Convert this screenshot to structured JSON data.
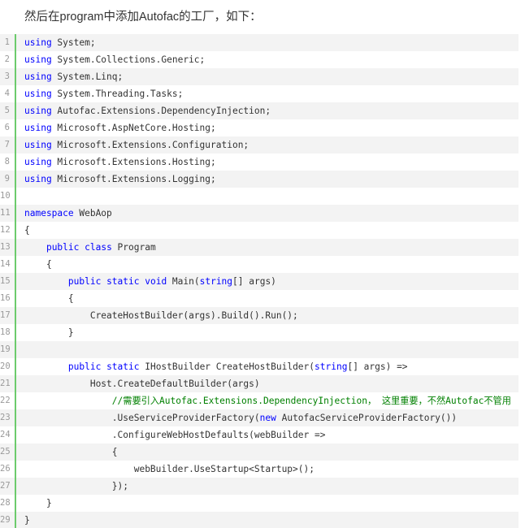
{
  "intro_text": "然后在program中添加Autofac的工厂，如下：",
  "colors": {
    "keyword": "#0000ff",
    "comment": "#008000",
    "text": "#333333",
    "line_number": "#9a9a9a",
    "gutter_border": "#6ccb6c",
    "odd_line_bg": "#f3f3f3"
  },
  "code_lines": [
    {
      "number": "1",
      "indent": "",
      "tokens": [
        {
          "t": "using",
          "k": "kw"
        },
        {
          "t": " System;",
          "k": ""
        }
      ]
    },
    {
      "number": "2",
      "indent": "",
      "tokens": [
        {
          "t": "using",
          "k": "kw"
        },
        {
          "t": " System.Collections.Generic;",
          "k": ""
        }
      ]
    },
    {
      "number": "3",
      "indent": "",
      "tokens": [
        {
          "t": "using",
          "k": "kw"
        },
        {
          "t": " System.Linq;",
          "k": ""
        }
      ]
    },
    {
      "number": "4",
      "indent": "",
      "tokens": [
        {
          "t": "using",
          "k": "kw"
        },
        {
          "t": " System.Threading.Tasks;",
          "k": ""
        }
      ]
    },
    {
      "number": "5",
      "indent": "",
      "tokens": [
        {
          "t": "using",
          "k": "kw"
        },
        {
          "t": " Autofac.Extensions.DependencyInjection;",
          "k": ""
        }
      ]
    },
    {
      "number": "6",
      "indent": "",
      "tokens": [
        {
          "t": "using",
          "k": "kw"
        },
        {
          "t": " Microsoft.AspNetCore.Hosting;",
          "k": ""
        }
      ]
    },
    {
      "number": "7",
      "indent": "",
      "tokens": [
        {
          "t": "using",
          "k": "kw"
        },
        {
          "t": " Microsoft.Extensions.Configuration;",
          "k": ""
        }
      ]
    },
    {
      "number": "8",
      "indent": "",
      "tokens": [
        {
          "t": "using",
          "k": "kw"
        },
        {
          "t": " Microsoft.Extensions.Hosting;",
          "k": ""
        }
      ]
    },
    {
      "number": "9",
      "indent": "",
      "tokens": [
        {
          "t": "using",
          "k": "kw"
        },
        {
          "t": " Microsoft.Extensions.Logging;",
          "k": ""
        }
      ]
    },
    {
      "number": "10",
      "indent": "",
      "tokens": []
    },
    {
      "number": "11",
      "indent": "",
      "tokens": [
        {
          "t": "namespace",
          "k": "kw"
        },
        {
          "t": " WebAop",
          "k": ""
        }
      ]
    },
    {
      "number": "12",
      "indent": "",
      "tokens": [
        {
          "t": "{",
          "k": ""
        }
      ]
    },
    {
      "number": "13",
      "indent": "    ",
      "tokens": [
        {
          "t": "public",
          "k": "kw"
        },
        {
          "t": " ",
          "k": ""
        },
        {
          "t": "class",
          "k": "kw"
        },
        {
          "t": " Program",
          "k": ""
        }
      ]
    },
    {
      "number": "14",
      "indent": "    ",
      "tokens": [
        {
          "t": "{",
          "k": ""
        }
      ]
    },
    {
      "number": "15",
      "indent": "        ",
      "tokens": [
        {
          "t": "public",
          "k": "kw"
        },
        {
          "t": " ",
          "k": ""
        },
        {
          "t": "static",
          "k": "kw"
        },
        {
          "t": " ",
          "k": ""
        },
        {
          "t": "void",
          "k": "kw"
        },
        {
          "t": " Main(",
          "k": ""
        },
        {
          "t": "string",
          "k": "kw"
        },
        {
          "t": "[] args)",
          "k": ""
        }
      ]
    },
    {
      "number": "16",
      "indent": "        ",
      "tokens": [
        {
          "t": "{",
          "k": ""
        }
      ]
    },
    {
      "number": "17",
      "indent": "            ",
      "tokens": [
        {
          "t": "CreateHostBuilder(args).Build().Run();",
          "k": ""
        }
      ]
    },
    {
      "number": "18",
      "indent": "        ",
      "tokens": [
        {
          "t": "}",
          "k": ""
        }
      ]
    },
    {
      "number": "19",
      "indent": "",
      "tokens": []
    },
    {
      "number": "20",
      "indent": "        ",
      "tokens": [
        {
          "t": "public",
          "k": "kw"
        },
        {
          "t": " ",
          "k": ""
        },
        {
          "t": "static",
          "k": "kw"
        },
        {
          "t": " IHostBuilder CreateHostBuilder(",
          "k": ""
        },
        {
          "t": "string",
          "k": "kw"
        },
        {
          "t": "[] args) =>",
          "k": ""
        }
      ]
    },
    {
      "number": "21",
      "indent": "            ",
      "tokens": [
        {
          "t": "Host.CreateDefaultBuilder(args)",
          "k": ""
        }
      ]
    },
    {
      "number": "22",
      "indent": "                ",
      "tokens": [
        {
          "t": "//需要引入Autofac.Extensions.DependencyInjection， 这里重要，不然Autofac不管用",
          "k": "cm"
        }
      ]
    },
    {
      "number": "23",
      "indent": "                ",
      "tokens": [
        {
          "t": ".UseServiceProviderFactory(",
          "k": ""
        },
        {
          "t": "new",
          "k": "kw"
        },
        {
          "t": " AutofacServiceProviderFactory())",
          "k": ""
        }
      ]
    },
    {
      "number": "24",
      "indent": "                ",
      "tokens": [
        {
          "t": ".ConfigureWebHostDefaults(webBuilder =>",
          "k": ""
        }
      ]
    },
    {
      "number": "25",
      "indent": "                ",
      "tokens": [
        {
          "t": "{",
          "k": ""
        }
      ]
    },
    {
      "number": "26",
      "indent": "                    ",
      "tokens": [
        {
          "t": "webBuilder.UseStartup<Startup>();",
          "k": ""
        }
      ]
    },
    {
      "number": "27",
      "indent": "                ",
      "tokens": [
        {
          "t": "});",
          "k": ""
        }
      ]
    },
    {
      "number": "28",
      "indent": "    ",
      "tokens": [
        {
          "t": "}",
          "k": ""
        }
      ]
    },
    {
      "number": "29",
      "indent": "",
      "tokens": [
        {
          "t": "}",
          "k": ""
        }
      ]
    }
  ]
}
